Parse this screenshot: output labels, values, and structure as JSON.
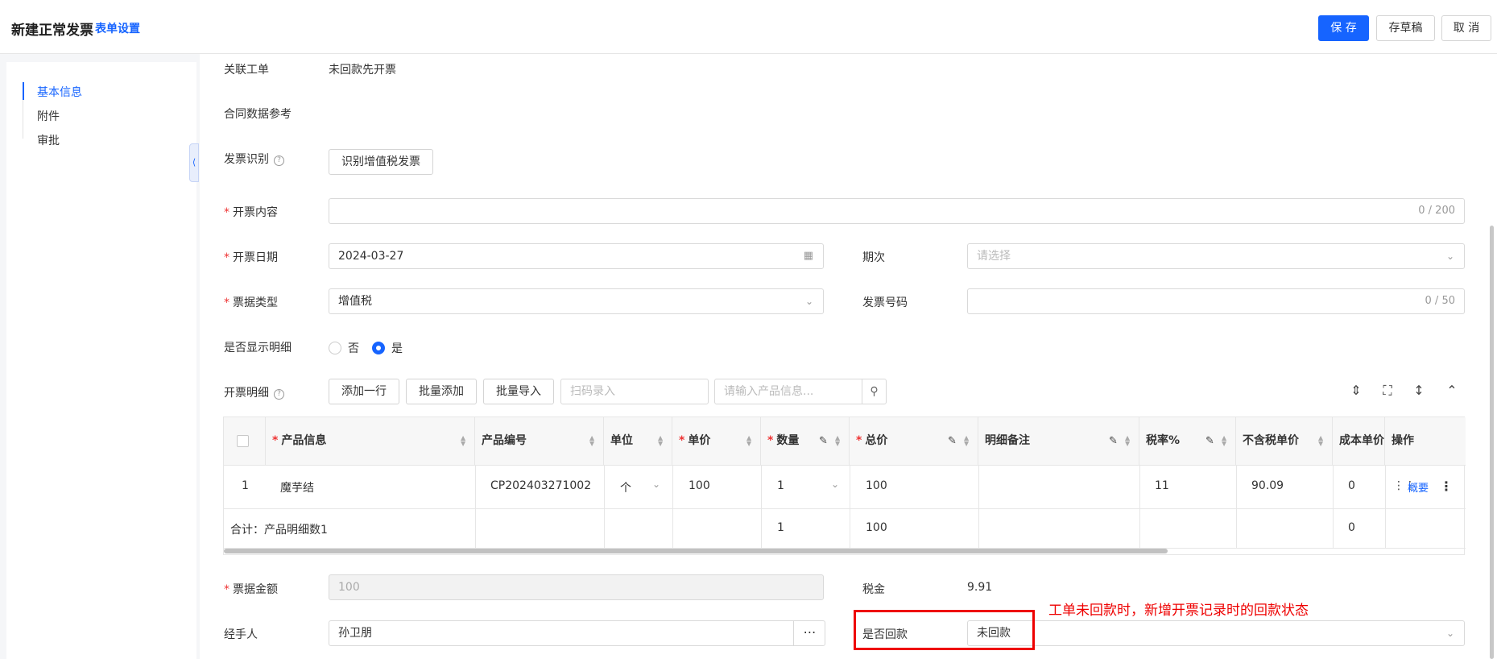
{
  "header": {
    "title": "新建正常发票",
    "form_settings": "表单设置",
    "save": "保 存",
    "draft": "存草稿",
    "cancel": "取 消"
  },
  "sidebar": {
    "items": [
      {
        "label": "基本信息",
        "active": true
      },
      {
        "label": "附件",
        "active": false
      },
      {
        "label": "审批",
        "active": false
      }
    ]
  },
  "form": {
    "related_order_label": "关联工单",
    "related_order_value": "未回款先开票",
    "contract_ref_label": "合同数据参考",
    "invoice_recognize_label": "发票识别",
    "invoice_recognize_button": "识别增值税发票",
    "content_label": "开票内容",
    "content_counter": "0 / 200",
    "date_label": "开票日期",
    "date_value": "2024-03-27",
    "period_label": "期次",
    "period_placeholder": "请选择",
    "bill_type_label": "票据类型",
    "bill_type_value": "增值税",
    "invoice_no_label": "发票号码",
    "invoice_no_counter": "0 / 50",
    "show_detail_label": "是否显示明细",
    "show_detail_options": [
      "否",
      "是"
    ],
    "show_detail_selected": "是",
    "detail_label": "开票明细",
    "add_row": "添加一行",
    "batch_add": "批量添加",
    "batch_import": "批量导入",
    "scan_placeholder": "扫码录入",
    "product_search_placeholder": "请输入产品信息...",
    "amount_label": "票据金额",
    "amount_value": "100",
    "tax_label": "税金",
    "tax_value": "9.91",
    "handler_label": "经手人",
    "handler_value": "孙卫朋",
    "paid_label": "是否回款",
    "paid_value": "未回款"
  },
  "table": {
    "columns": [
      "产品信息",
      "产品编号",
      "单位",
      "单价",
      "数量",
      "总价",
      "明细备注",
      "税率%",
      "不含税单价",
      "成本单价",
      "操作"
    ],
    "row": {
      "index": "1",
      "product": "魔芋结",
      "code": "CP202403271002",
      "unit": "个",
      "price": "100",
      "qty": "1",
      "total": "100",
      "note": "",
      "tax_rate": "11",
      "net_price": "90.09",
      "cost": "0",
      "action": "概要"
    },
    "summary": {
      "label": "合计：产品明细数1",
      "qty": "1",
      "total": "100",
      "cost": "0"
    }
  },
  "annotation": "工单未回款时，新增开票记录时的回款状态"
}
